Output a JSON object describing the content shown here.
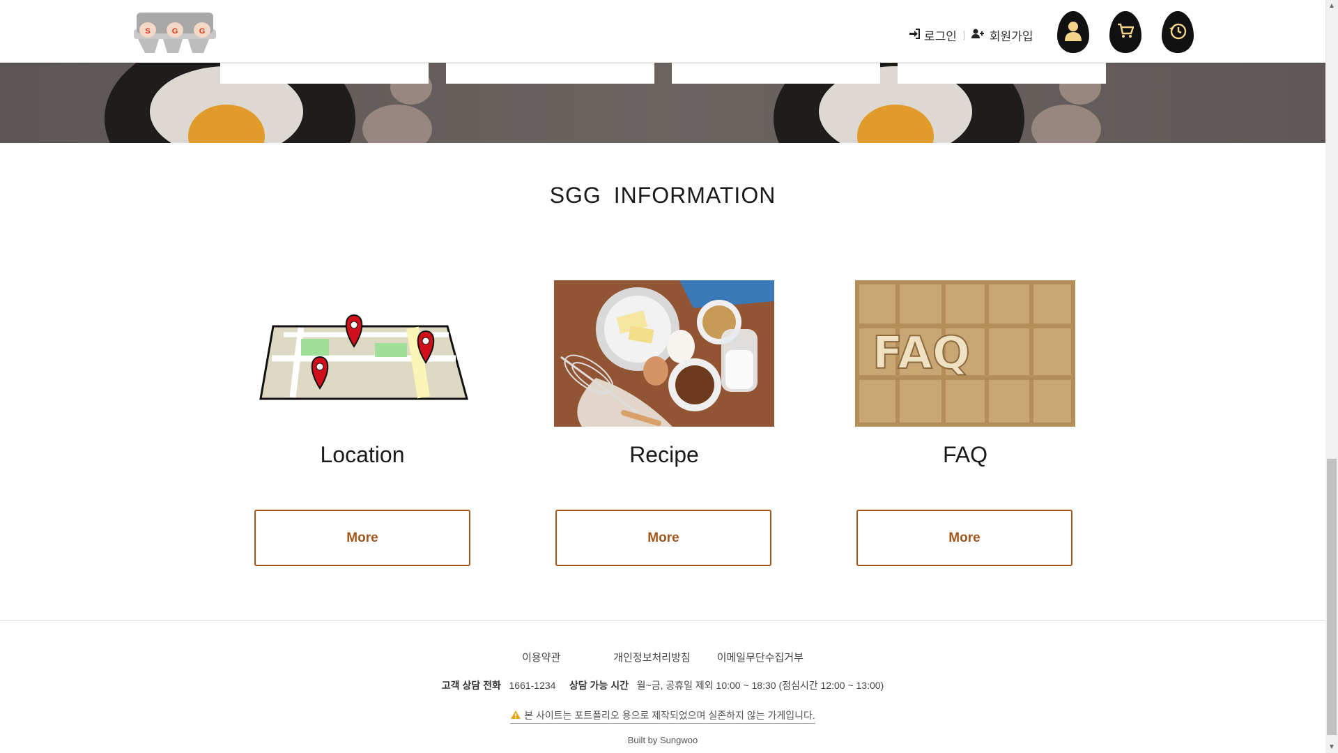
{
  "header": {
    "logo_letters": [
      "S",
      "G",
      "G"
    ],
    "login_label": "로그인",
    "signup_label": "회원가입",
    "icon_buttons": [
      "user-icon",
      "cart-icon",
      "history-icon"
    ],
    "icon_color": "#f5d58a"
  },
  "info": {
    "title": "SGG  INFORMATION",
    "cards": [
      {
        "title": "Location",
        "button": "More",
        "image": "map-pins-illustration"
      },
      {
        "title": "Recipe",
        "button": "More",
        "image": "baking-ingredients-photo"
      },
      {
        "title": "FAQ",
        "button": "More",
        "image": "faq-wooden-letters-photo",
        "image_letters": "FAQ"
      }
    ],
    "accent_color": "#a0551b"
  },
  "footer": {
    "links": [
      "이용약관",
      "개인정보처리방침",
      "이메일무단수집거부"
    ],
    "phone_label": "고객 상담 전화",
    "phone": "1661-1234",
    "hours_label": "상담 가능 시간",
    "hours": "월~금, 공휴일 제외 10:00 ~ 18:30 (점심시간 12:00 ~ 13:00)",
    "notice": "본 사이트는 포트폴리오 용으로 제작되었으며 실존하지 않는 가게입니다.",
    "built_by": "Built by Sungwoo"
  }
}
